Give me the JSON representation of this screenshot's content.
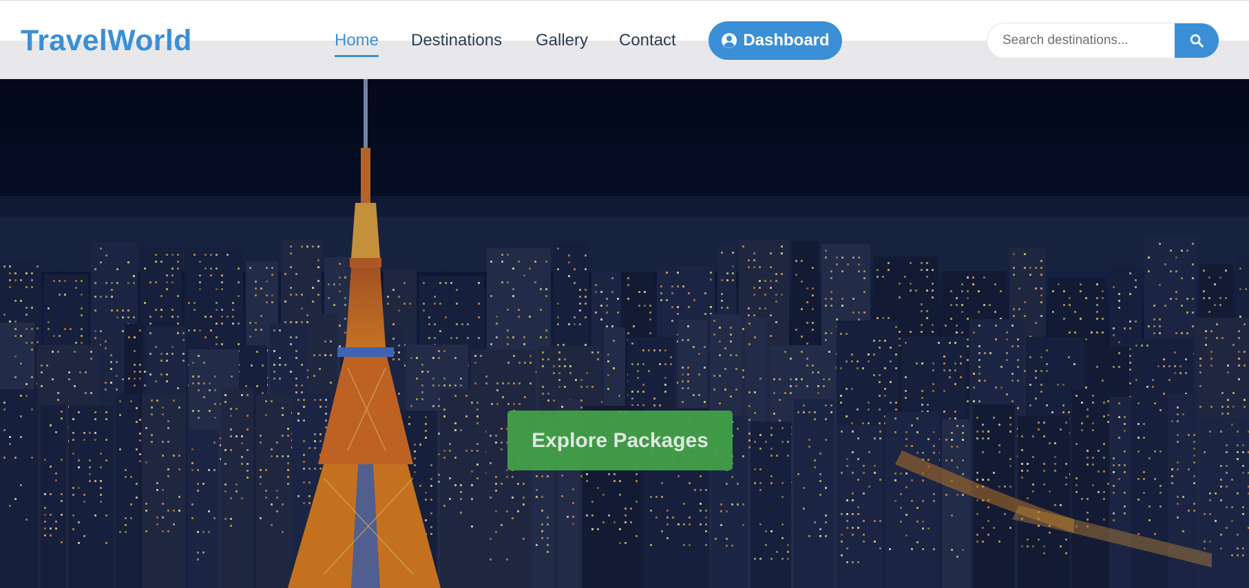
{
  "brand": {
    "name": "TravelWorld"
  },
  "nav": {
    "items": [
      {
        "label": "Home",
        "active": true
      },
      {
        "label": "Destinations",
        "active": false
      },
      {
        "label": "Gallery",
        "active": false
      },
      {
        "label": "Contact",
        "active": false
      }
    ],
    "dashboard": {
      "label": "Dashboard",
      "icon": "user-circle-icon"
    }
  },
  "search": {
    "placeholder": "Search destinations...",
    "value": "",
    "icon": "search-icon"
  },
  "hero": {
    "background": "night city skyline with illuminated tower",
    "cta_label": "Explore Packages"
  },
  "colors": {
    "brand_blue": "#3a8fd6",
    "nav_text": "#2c3e50",
    "cta_green": "#43a047",
    "hero_dark": "#0b1226"
  }
}
